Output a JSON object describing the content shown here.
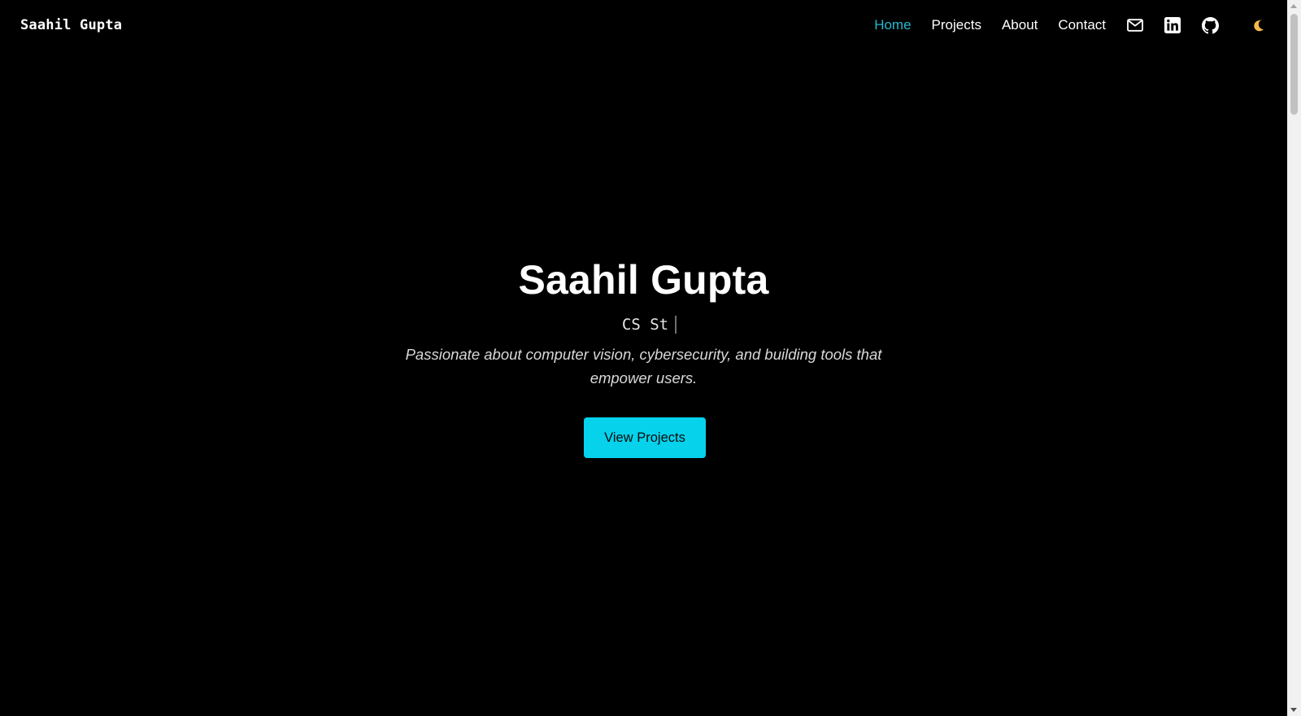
{
  "navbar": {
    "brand": "Saahil Gupta",
    "links": [
      {
        "label": "Home",
        "active": true
      },
      {
        "label": "Projects",
        "active": false
      },
      {
        "label": "About",
        "active": false
      },
      {
        "label": "Contact",
        "active": false
      }
    ],
    "icons": [
      "mail-icon",
      "linkedin-icon",
      "github-icon",
      "moon-icon"
    ]
  },
  "hero": {
    "name": "Saahil Gupta",
    "role_typed": "CS St",
    "tagline": "Passionate about computer vision, cybersecurity, and building tools that empower users.",
    "cta_label": "View Projects"
  },
  "colors": {
    "background": "#000000",
    "accent": "#22b8cf",
    "button": "#06d2ec",
    "moon": "#f5b84a"
  }
}
